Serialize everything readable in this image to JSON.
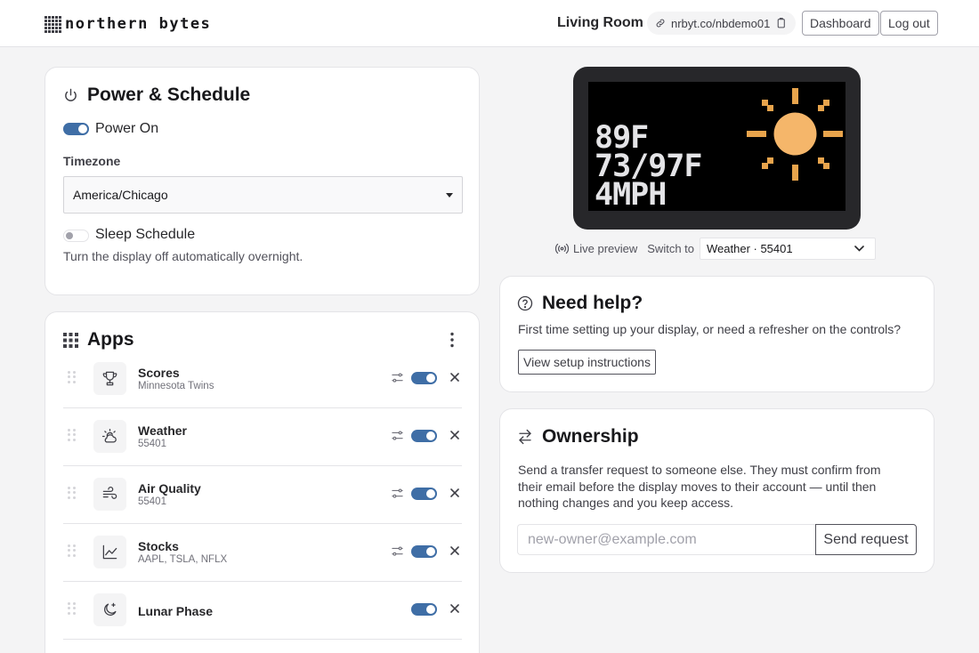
{
  "header": {
    "logo_text": "northern bytes",
    "room_name": "Living Room",
    "device_url": "nrbyt.co/nbdemo01",
    "dashboard_label": "Dashboard",
    "logout_label": "Log out"
  },
  "power": {
    "title": "Power & Schedule",
    "power_label": "Power On",
    "power_on": true,
    "timezone_label": "Timezone",
    "timezone_value": "America/Chicago",
    "sleep_label": "Sleep Schedule",
    "sleep_on": false,
    "sleep_help": "Turn the display off automatically overnight."
  },
  "apps": {
    "title": "Apps",
    "items": [
      {
        "name": "Scores",
        "subtitle": "Minnesota Twins",
        "icon": "trophy-icon",
        "enabled": true,
        "configurable": true
      },
      {
        "name": "Weather",
        "subtitle": "55401",
        "icon": "cloud-sun-icon",
        "enabled": true,
        "configurable": true
      },
      {
        "name": "Air Quality",
        "subtitle": "55401",
        "icon": "wind-icon",
        "enabled": true,
        "configurable": true
      },
      {
        "name": "Stocks",
        "subtitle": "AAPL, TSLA, NFLX",
        "icon": "trend-chart-icon",
        "enabled": true,
        "configurable": true
      },
      {
        "name": "Lunar Phase",
        "subtitle": "",
        "icon": "moon-star-icon",
        "enabled": true,
        "configurable": false
      }
    ]
  },
  "preview": {
    "screen": {
      "line1": "89F",
      "line2": "73/97F",
      "line3": "4MPH"
    },
    "live_label": "Live preview",
    "switch_label": "Switch to",
    "switch_value": "Weather · 55401"
  },
  "help": {
    "title": "Need help?",
    "body": "First time setting up your display, or need a refresher on the controls?",
    "button_label": "View setup instructions"
  },
  "ownership": {
    "title": "Ownership",
    "body": "Send a transfer request to someone else. They must confirm from their email before the display moves to their account — until then nothing changes and you keep access.",
    "email_placeholder": "new-owner@example.com",
    "send_label": "Send request"
  },
  "colors": {
    "accent": "#3f6ea6",
    "sun": "#f5b66a",
    "sun_rays": "#e8a44c"
  }
}
